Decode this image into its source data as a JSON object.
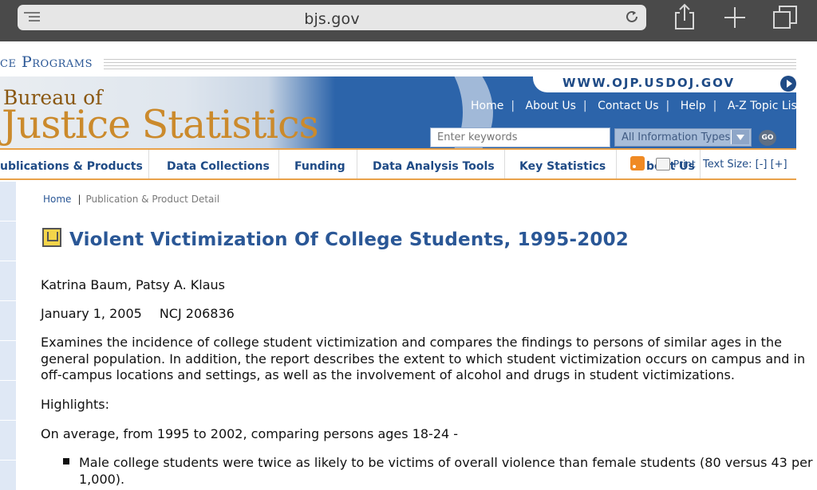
{
  "browser": {
    "url": "bjs.gov",
    "icons": [
      "menu-icon",
      "reload-icon",
      "share-icon",
      "new-tab-icon",
      "tabs-icon"
    ]
  },
  "header": {
    "programs_text": "ce Programs",
    "logo_line1": "Bureau of",
    "logo_line2": "Justice Statistics",
    "ojp_link": "WWW.OJP.USDOJ.GOV",
    "top_links": [
      "Home",
      "About Us",
      "Contact Us",
      "Help",
      "A-Z Topic List"
    ],
    "search_placeholder": "Enter keywords",
    "search_type": "All Information Types",
    "go_label": "GO"
  },
  "nav": {
    "items": [
      "ublications & Products",
      "Data Collections",
      "Funding",
      "Data Analysis Tools",
      "Key Statistics",
      "bout Us"
    ],
    "print_label": "Print",
    "text_size": "Text Size: [-] [+]"
  },
  "breadcrumb": {
    "home": "Home",
    "current": "Publication & Product Detail"
  },
  "publication": {
    "title": "Violent Victimization Of College Students, 1995-2002",
    "authors": "Katrina Baum, Patsy A. Klaus",
    "date": "January 1, 2005",
    "ncj": "NCJ 206836",
    "abstract": "Examines the incidence of college student victimization and compares the findings to persons of similar ages in the general population. In addition, the report describes the extent to which student victimization occurs on campus and in off-campus locations and settings, as well as the involvement of alcohol and drugs in student victimizations.",
    "highlights_label": "Highlights:",
    "average_line": "On average, from 1995 to 2002, comparing persons ages 18-24 -",
    "highlights": [
      "Male college students were twice as likely to be victims of overall violence than female students (80 versus 43 per 1,000)."
    ]
  },
  "colors": {
    "chrome": "#4a4a4a",
    "banner_blue": "#2c64aa",
    "link_blue": "#2a5796",
    "nav_orange": "#e9a24a",
    "logo_gold": "#cb8a2c"
  }
}
